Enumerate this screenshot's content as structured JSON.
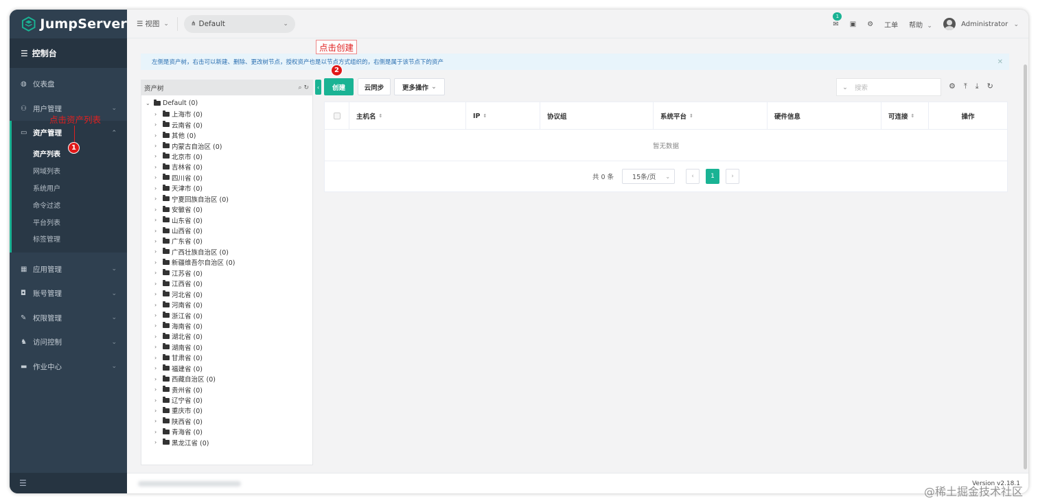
{
  "app": {
    "name": "JumpServer",
    "version": "Version v2.18.1"
  },
  "sidebar": {
    "console": "控制台",
    "items": [
      {
        "label": "仪表盘",
        "icon": "dashboard-icon"
      },
      {
        "label": "用户管理",
        "icon": "users-icon"
      }
    ],
    "asset_group": {
      "label": "资产管理",
      "subitems": [
        "资产列表",
        "网域列表",
        "系统用户",
        "命令过滤",
        "平台列表",
        "标签管理"
      ]
    },
    "items_after": [
      {
        "label": "应用管理",
        "icon": "apps-icon"
      },
      {
        "label": "账号管理",
        "icon": "account-icon"
      },
      {
        "label": "权限管理",
        "icon": "permission-icon"
      },
      {
        "label": "访问控制",
        "icon": "access-control-icon"
      },
      {
        "label": "作业中心",
        "icon": "jobs-icon"
      }
    ]
  },
  "topbar": {
    "view_menu": "视图",
    "org": "Default",
    "mail_badge": "1",
    "tickets": "工单",
    "help": "帮助",
    "user": "Administrator"
  },
  "alert": {
    "text": "左侧是资产树，右击可以新建、删除、更改树节点，授权资产也是以节点方式组织的，右侧是属于该节点下的资产"
  },
  "tree": {
    "title": "资产树",
    "root": "Default (0)",
    "nodes": [
      "上海市 (0)",
      "云南省 (0)",
      "其他 (0)",
      "内蒙古自治区 (0)",
      "北京市 (0)",
      "吉林省 (0)",
      "四川省 (0)",
      "天津市 (0)",
      "宁夏回族自治区 (0)",
      "安徽省 (0)",
      "山东省 (0)",
      "山西省 (0)",
      "广东省 (0)",
      "广西壮族自治区 (0)",
      "新疆维吾尔自治区 (0)",
      "江苏省 (0)",
      "江西省 (0)",
      "河北省 (0)",
      "河南省 (0)",
      "浙江省 (0)",
      "海南省 (0)",
      "湖北省 (0)",
      "湖南省 (0)",
      "甘肃省 (0)",
      "福建省 (0)",
      "西藏自治区 (0)",
      "贵州省 (0)",
      "辽宁省 (0)",
      "重庆市 (0)",
      "陕西省 (0)",
      "青海省 (0)",
      "黑龙江省 (0)"
    ]
  },
  "toolbar": {
    "create": "创建",
    "cloud_sync": "云同步",
    "more_actions": "更多操作",
    "search_placeholder": "搜索"
  },
  "table": {
    "columns": [
      "主机名",
      "IP",
      "协议组",
      "系统平台",
      "硬件信息",
      "可连接",
      "操作"
    ],
    "empty_text": "暂无数据"
  },
  "pagination": {
    "total": "共 0 条",
    "page_size": "15条/页",
    "current_page": "1"
  },
  "annotations": {
    "click_asset_list": "点击资产列表",
    "click_create": "点击创建",
    "step1": "1",
    "step2": "2"
  },
  "watermark": "@稀土掘金技术社区",
  "colors": {
    "sidebar": "#2f4050",
    "accent": "#1ab394",
    "annotation": "#e02020"
  }
}
